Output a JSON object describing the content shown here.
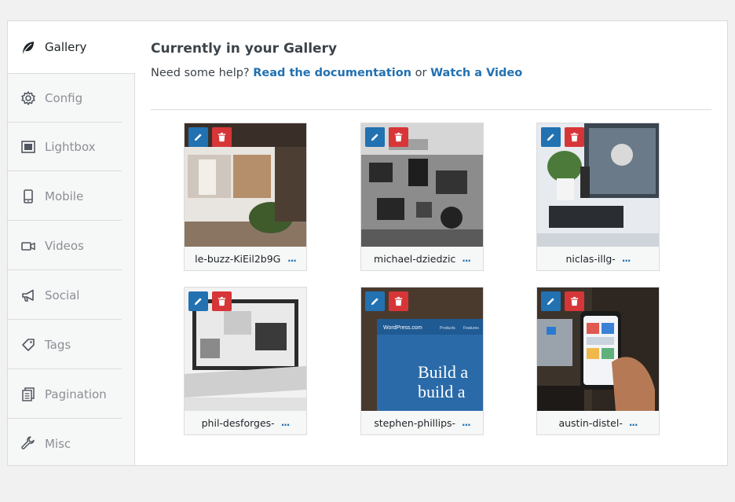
{
  "sidebar": {
    "items": [
      {
        "label": "Gallery",
        "icon": "leaf-icon",
        "active": true
      },
      {
        "label": "Config",
        "icon": "gear-icon"
      },
      {
        "label": "Lightbox",
        "icon": "lightbox-icon"
      },
      {
        "label": "Mobile",
        "icon": "mobile-icon"
      },
      {
        "label": "Videos",
        "icon": "video-camera-icon"
      },
      {
        "label": "Social",
        "icon": "megaphone-icon"
      },
      {
        "label": "Tags",
        "icon": "tag-icon"
      },
      {
        "label": "Pagination",
        "icon": "pages-icon"
      },
      {
        "label": "Misc",
        "icon": "wrench-icon"
      }
    ]
  },
  "main": {
    "title": "Currently in your Gallery",
    "help_prefix": "Need some help?",
    "help_link1": "Read the documentation",
    "help_or": "or",
    "help_link2": "Watch a Video"
  },
  "gallery": [
    {
      "name": "le-buzz-KiEil2b9Gk",
      "more": "..."
    },
    {
      "name": "michael-dziedzic",
      "more": "..."
    },
    {
      "name": "niclas-illg-",
      "more": "..."
    },
    {
      "name": "phil-desforges-",
      "more": "..."
    },
    {
      "name": "stephen-phillips-",
      "more": "..."
    },
    {
      "name": "austin-distel-",
      "more": "..."
    }
  ],
  "thumb_text": {
    "wp_brand": "WordPress.com",
    "wp_menu1": "Products",
    "wp_menu2": "Features",
    "wp_line1": "Build a",
    "wp_line2": "build a"
  },
  "colors": {
    "accent": "#2271b1",
    "delete": "#d63638"
  }
}
